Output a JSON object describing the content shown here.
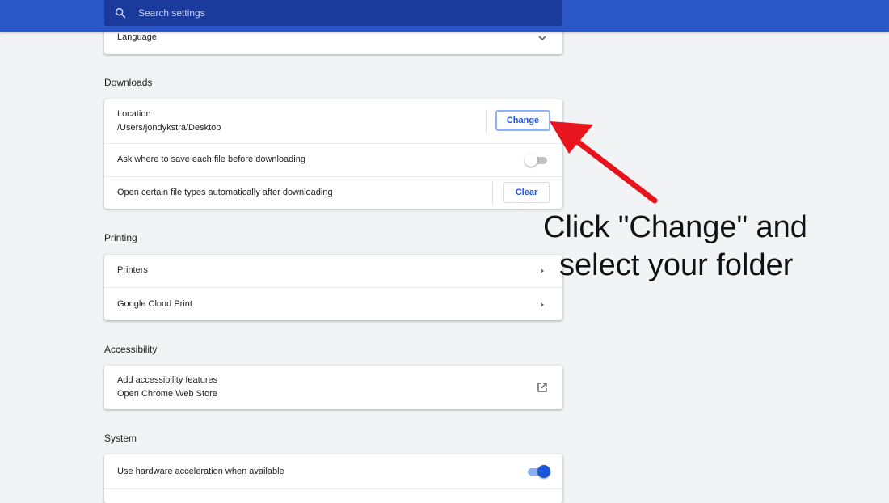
{
  "search": {
    "placeholder": "Search settings",
    "icon": "search-icon"
  },
  "language_card": {
    "label": "Language"
  },
  "downloads": {
    "title": "Downloads",
    "location_label": "Location",
    "location_path": "/Users/jondykstra/Desktop",
    "change_button": "Change",
    "ask_label": "Ask where to save each file before downloading",
    "ask_enabled": false,
    "auto_open_label": "Open certain file types automatically after downloading",
    "clear_button": "Clear"
  },
  "printing": {
    "title": "Printing",
    "items": [
      {
        "label": "Printers"
      },
      {
        "label": "Google Cloud Print"
      }
    ]
  },
  "accessibility": {
    "title": "Accessibility",
    "item_label": "Add accessibility features",
    "item_sub": "Open Chrome Web Store"
  },
  "system": {
    "title": "System",
    "hw_accel_label": "Use hardware acceleration when available",
    "hw_accel_enabled": true
  },
  "annotation": {
    "line1": "Click \"Change\" and",
    "line2": "select your folder"
  },
  "colors": {
    "header": "#2a56c6",
    "search_bg": "#1a3a9c",
    "accent": "#1a56d6",
    "arrow": "#e8141c"
  }
}
